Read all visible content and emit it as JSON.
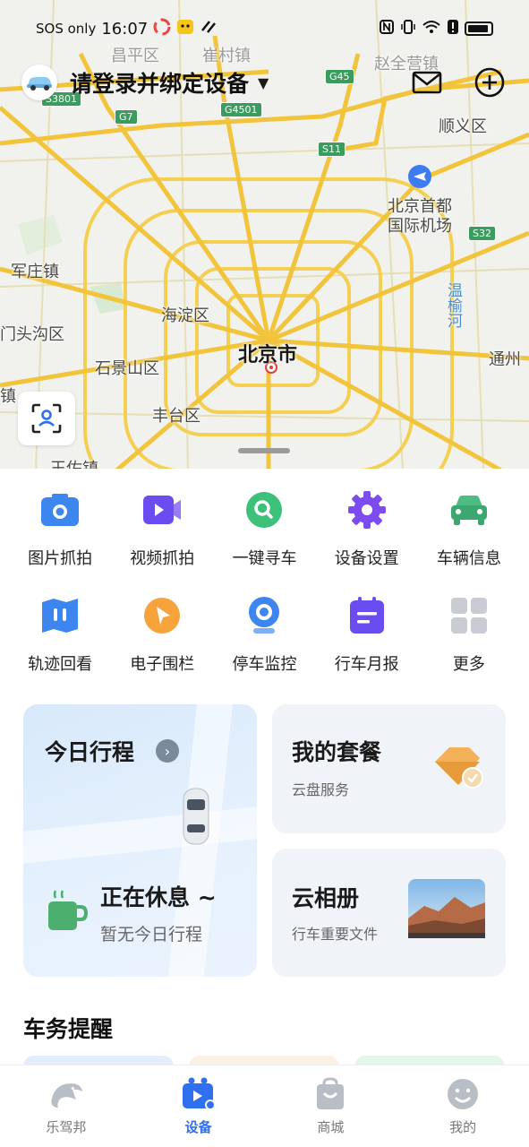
{
  "status_bar": {
    "carrier": "SOS only",
    "time": "16:07"
  },
  "header": {
    "title": "请登录并绑定设备",
    "caret": "▼"
  },
  "map": {
    "labels": {
      "beijing": "北京市",
      "haidian": "海淀区",
      "shijingshan": "石景山区",
      "fengtai": "丰台区",
      "mentougou": "门头沟区",
      "junzhuang": "军庄镇",
      "shunyi": "顺义区",
      "airport_line1": "北京首都",
      "airport_line2": "国际机场",
      "tongzhou": "通州",
      "changping": "昌平区",
      "cuicun": "崔村镇",
      "zhaoquanying": "赵全营镇",
      "wangzuo": "王佐镇",
      "edge_zhen": "镇",
      "wenyu_river": "温榆河"
    },
    "road_badges": {
      "s3801": "S3801",
      "g7": "G7",
      "g4501": "G4501",
      "g45": "G45",
      "s11": "S11",
      "s32": "S32"
    }
  },
  "functions": [
    {
      "label": "图片抓拍",
      "icon": "camera-icon"
    },
    {
      "label": "视频抓拍",
      "icon": "video-icon"
    },
    {
      "label": "一键寻车",
      "icon": "search-icon"
    },
    {
      "label": "设备设置",
      "icon": "gear-icon"
    },
    {
      "label": "车辆信息",
      "icon": "car-icon"
    },
    {
      "label": "轨迹回看",
      "icon": "map-icon"
    },
    {
      "label": "电子围栏",
      "icon": "fence-icon"
    },
    {
      "label": "停车监控",
      "icon": "parking-camera-icon"
    },
    {
      "label": "行车月报",
      "icon": "report-icon"
    },
    {
      "label": "更多",
      "icon": "more-grid-icon"
    }
  ],
  "cards": {
    "trip": {
      "title": "今日行程",
      "chevron": "›",
      "status": "正在休息 ~",
      "sub": "暂无今日行程"
    },
    "plan": {
      "title": "我的套餐",
      "sub": "云盘服务"
    },
    "album": {
      "title": "云相册",
      "sub": "行车重要文件"
    }
  },
  "section": {
    "title": "车务提醒"
  },
  "tabs": [
    {
      "label": "乐驾邦",
      "icon": "dolphin-icon",
      "active": false
    },
    {
      "label": "设备",
      "icon": "device-icon",
      "active": true
    },
    {
      "label": "商城",
      "icon": "shopping-bag-icon",
      "active": false
    },
    {
      "label": "我的",
      "icon": "smiley-icon",
      "active": false
    }
  ],
  "colors": {
    "accent": "#2f6ff0",
    "map_road": "#f4cf52",
    "card_bg": "#f0f3f7"
  }
}
